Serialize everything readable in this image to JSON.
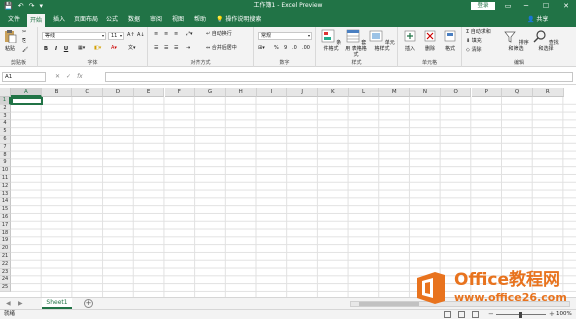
{
  "titlebar": {
    "title": "工作簿1 - Excel Preview",
    "login": "登录",
    "minimize": "─",
    "restore": "☐",
    "close": "✕",
    "qat": {
      "save": "💾",
      "undo": "↶",
      "redo": "↷",
      "customize": "▾"
    }
  },
  "tabs": [
    {
      "label": "文件"
    },
    {
      "label": "开始"
    },
    {
      "label": "插入"
    },
    {
      "label": "页面布局"
    },
    {
      "label": "公式"
    },
    {
      "label": "数据"
    },
    {
      "label": "审阅"
    },
    {
      "label": "视图"
    },
    {
      "label": "帮助"
    },
    {
      "label": "操作说明搜索"
    }
  ],
  "share": "共享",
  "ribbon": {
    "clipboard": {
      "paste": "粘贴",
      "label": "剪贴板"
    },
    "font": {
      "name": "等线",
      "size": "11",
      "bold": "B",
      "italic": "I",
      "underline": "U",
      "grow": "A↑",
      "shrink": "A↓",
      "label": "字体"
    },
    "alignment": {
      "wrap": "自动换行",
      "merge": "合并后居中",
      "label": "对齐方式"
    },
    "number": {
      "format": "常规",
      "percent": "%",
      "comma": "9",
      "label": "数字"
    },
    "styles": {
      "conditional": "条件格式",
      "table": "套用\n表格格式",
      "cell": "单元格样式",
      "label": "样式"
    },
    "cells": {
      "insert": "插入",
      "delete": "删除",
      "format": "格式",
      "label": "单元格"
    },
    "editing": {
      "autosum": "自动求和",
      "fill": "填充",
      "clear": "清除",
      "sort": "排序和筛选",
      "find": "查找和选择",
      "label": "编辑"
    }
  },
  "formula_bar": {
    "namebox": "A1",
    "cancel": "✕",
    "enter": "✓",
    "fx": "fx"
  },
  "grid": {
    "columns": [
      "A",
      "B",
      "C",
      "D",
      "E",
      "F",
      "G",
      "H",
      "I",
      "J",
      "K",
      "L",
      "M",
      "N",
      "O",
      "P",
      "Q",
      "R"
    ],
    "rows": [
      "1",
      "2",
      "3",
      "4",
      "5",
      "6",
      "7",
      "8",
      "9",
      "10",
      "11",
      "12",
      "13",
      "14",
      "15",
      "16",
      "17",
      "18",
      "19",
      "20",
      "21",
      "22",
      "23",
      "24",
      "25"
    ],
    "active_cell": "A1"
  },
  "sheets": [
    {
      "label": "Sheet1"
    }
  ],
  "add_sheet": "+",
  "status": {
    "ready": "就绪",
    "zoom": "100%",
    "minus": "−",
    "plus": "+"
  },
  "watermark": {
    "title": "Office教程网",
    "url": "www.office26.com"
  },
  "colors": {
    "accent": "#217346",
    "watermark": "#e8731e",
    "ribbon_bg": "#f3f3f3"
  }
}
